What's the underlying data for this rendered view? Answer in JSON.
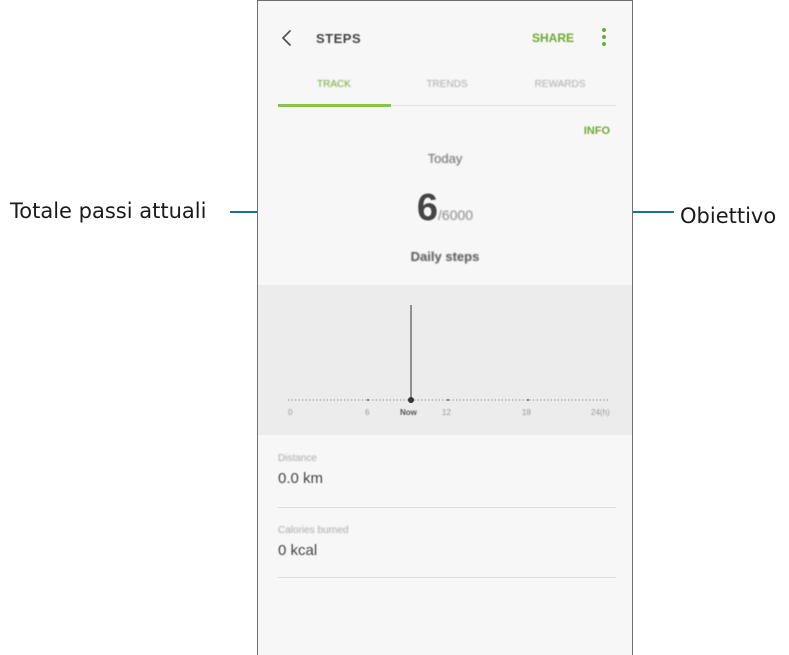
{
  "annotations": {
    "left": "Totale passi attuali",
    "right": "Obiettivo"
  },
  "header": {
    "title": "STEPS",
    "share_label": "SHARE"
  },
  "tabs": [
    {
      "label": "TRACK",
      "active": true
    },
    {
      "label": "TRENDS",
      "active": false
    },
    {
      "label": "REWARDS",
      "active": false
    }
  ],
  "info_label": "INFO",
  "today_label": "Today",
  "steps": {
    "current": "6",
    "goal": "/6000",
    "caption": "Daily steps"
  },
  "timeline": {
    "ticks": [
      "0",
      "6",
      "Now",
      "12",
      "18",
      "24(h)"
    ]
  },
  "stats": [
    {
      "label": "Distance",
      "value": "0.0 km"
    },
    {
      "label": "Calories burned",
      "value": "0 kcal"
    }
  ],
  "colors": {
    "accent": "#6fa833",
    "callout_line": "#1c6f9e",
    "chart_bg": "#ececec"
  }
}
